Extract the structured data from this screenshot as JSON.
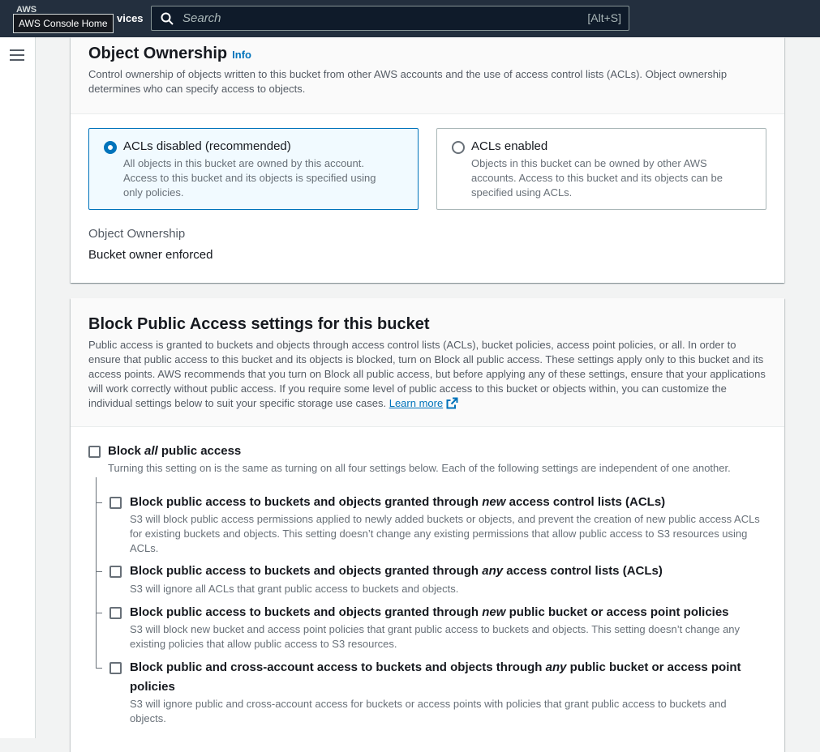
{
  "header": {
    "brand_fragment": "AWS",
    "services_fragment": "vices",
    "search": {
      "placeholder": "Search",
      "shortcut": "[Alt+S]"
    },
    "tooltip": "AWS Console Home"
  },
  "object_ownership": {
    "title": "Object Ownership",
    "info_label": "Info",
    "description": "Control ownership of objects written to this bucket from other AWS accounts and the use of access control lists (ACLs). Object ownership determines who can specify access to objects.",
    "options": [
      {
        "title": "ACLs disabled (recommended)",
        "description": "All objects in this bucket are owned by this account. Access to this bucket and its objects is specified using only policies.",
        "selected": true
      },
      {
        "title": "ACLs enabled",
        "description": "Objects in this bucket can be owned by other AWS accounts. Access to this bucket and its objects can be specified using ACLs.",
        "selected": false
      }
    ],
    "setting_label": "Object Ownership",
    "setting_value": "Bucket owner enforced"
  },
  "block_public_access": {
    "title": "Block Public Access settings for this bucket",
    "description": "Public access is granted to buckets and objects through access control lists (ACLs), bucket policies, access point policies, or all. In order to ensure that public access to this bucket and its objects is blocked, turn on Block all public access. These settings apply only to this bucket and its access points. AWS recommends that you turn on Block all public access, but before applying any of these settings, ensure that your applications will work correctly without public access. If you require some level of public access to this bucket or objects within, you can customize the individual settings below to suit your specific storage use cases.",
    "learn_more": "Learn more",
    "block_all": {
      "label_before": "Block ",
      "label_em": "all",
      "label_after": " public access",
      "description": "Turning this setting on is the same as turning on all four settings below. Each of the following settings are independent of one another.",
      "checked": false
    },
    "settings": [
      {
        "label_before": "Block public access to buckets and objects granted through ",
        "label_em": "new",
        "label_after": " access control lists (ACLs)",
        "description": "S3 will block public access permissions applied to newly added buckets or objects, and prevent the creation of new public access ACLs for existing buckets and objects. This setting doesn’t change any existing permissions that allow public access to S3 resources using ACLs.",
        "checked": false
      },
      {
        "label_before": "Block public access to buckets and objects granted through ",
        "label_em": "any",
        "label_after": " access control lists (ACLs)",
        "description": "S3 will ignore all ACLs that grant public access to buckets and objects.",
        "checked": false
      },
      {
        "label_before": "Block public access to buckets and objects granted through ",
        "label_em": "new",
        "label_after": " public bucket or access point policies",
        "description": "S3 will block new bucket and access point policies that grant public access to buckets and objects. This setting doesn’t change any existing policies that allow public access to S3 resources.",
        "checked": false
      },
      {
        "label_before": "Block public and cross-account access to buckets and objects through ",
        "label_em": "any",
        "label_after": " public bucket or access point policies",
        "description": "S3 will ignore public and cross-account access for buckets or access points with policies that grant public access to buckets and objects.",
        "checked": false
      }
    ]
  },
  "colors": {
    "topbar": "#232f3e",
    "link": "#0073bb",
    "selected_tile_bg": "#f1faff"
  }
}
